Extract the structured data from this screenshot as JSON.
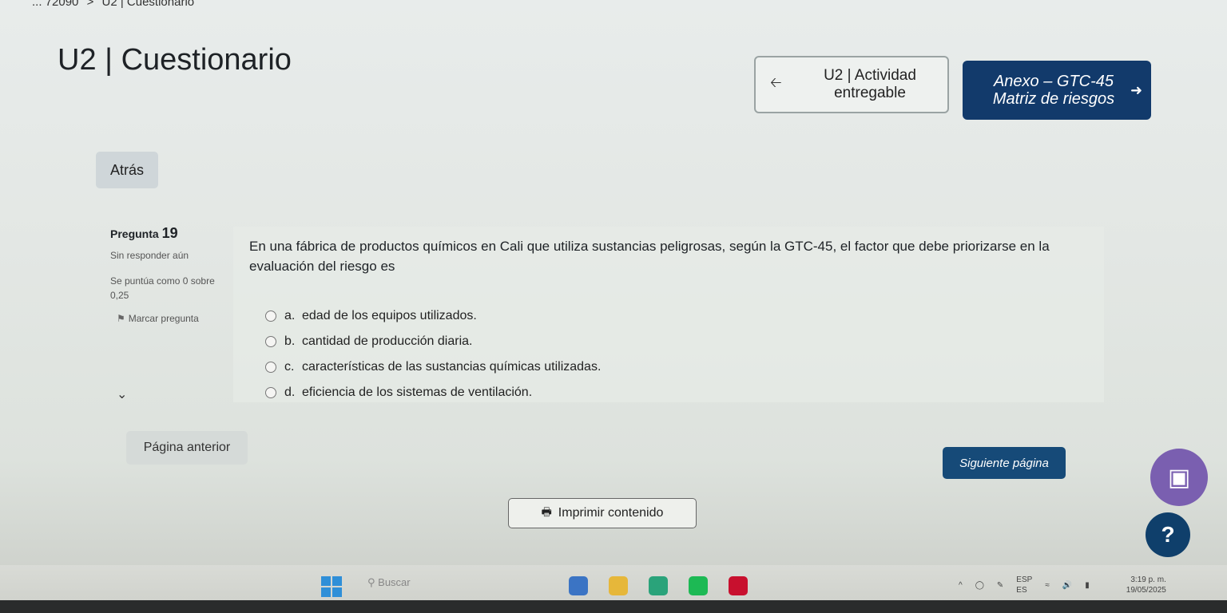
{
  "breadcrumb": {
    "prefix": "... 72090",
    "sep": ">",
    "current": "U2 | Cuestionario"
  },
  "page_title": "U2 | Cuestionario",
  "activity_nav": {
    "prev": {
      "line1": "U2 | Actividad",
      "line2": "entregable"
    },
    "next": {
      "line1": "Anexo – GTC-45",
      "line2": "Matriz de riesgos"
    }
  },
  "back_label": "Atrás",
  "question": {
    "label": "Pregunta",
    "number": "19",
    "status": "Sin responder aún",
    "grade": "Se puntúa como 0 sobre 0,25",
    "flag_label": "Marcar pregunta",
    "text": "En una fábrica de productos químicos en Cali que utiliza sustancias peligrosas, según la GTC-45, el factor que debe priorizarse en la evaluación del riesgo es",
    "answers": [
      {
        "letter": "a.",
        "text": "edad de los equipos utilizados."
      },
      {
        "letter": "b.",
        "text": "cantidad de producción diaria."
      },
      {
        "letter": "c.",
        "text": "características de las sustancias químicas utilizadas."
      },
      {
        "letter": "d.",
        "text": "eficiencia de los sistemas de ventilación."
      }
    ]
  },
  "pagination": {
    "prev_label": "Página anterior",
    "next_label": "Siguiente página"
  },
  "print_label": "Imprimir contenido",
  "help_label": "?",
  "taskbar": {
    "search_placeholder": "Buscar",
    "lang_top": "ESP",
    "lang_bottom": "ES",
    "time": "3:19 p. m.",
    "date": "19/05/2025"
  },
  "colors": {
    "primary": "#123a6b",
    "chat": "#7a5fb0",
    "windows": "#2f8fd8"
  }
}
